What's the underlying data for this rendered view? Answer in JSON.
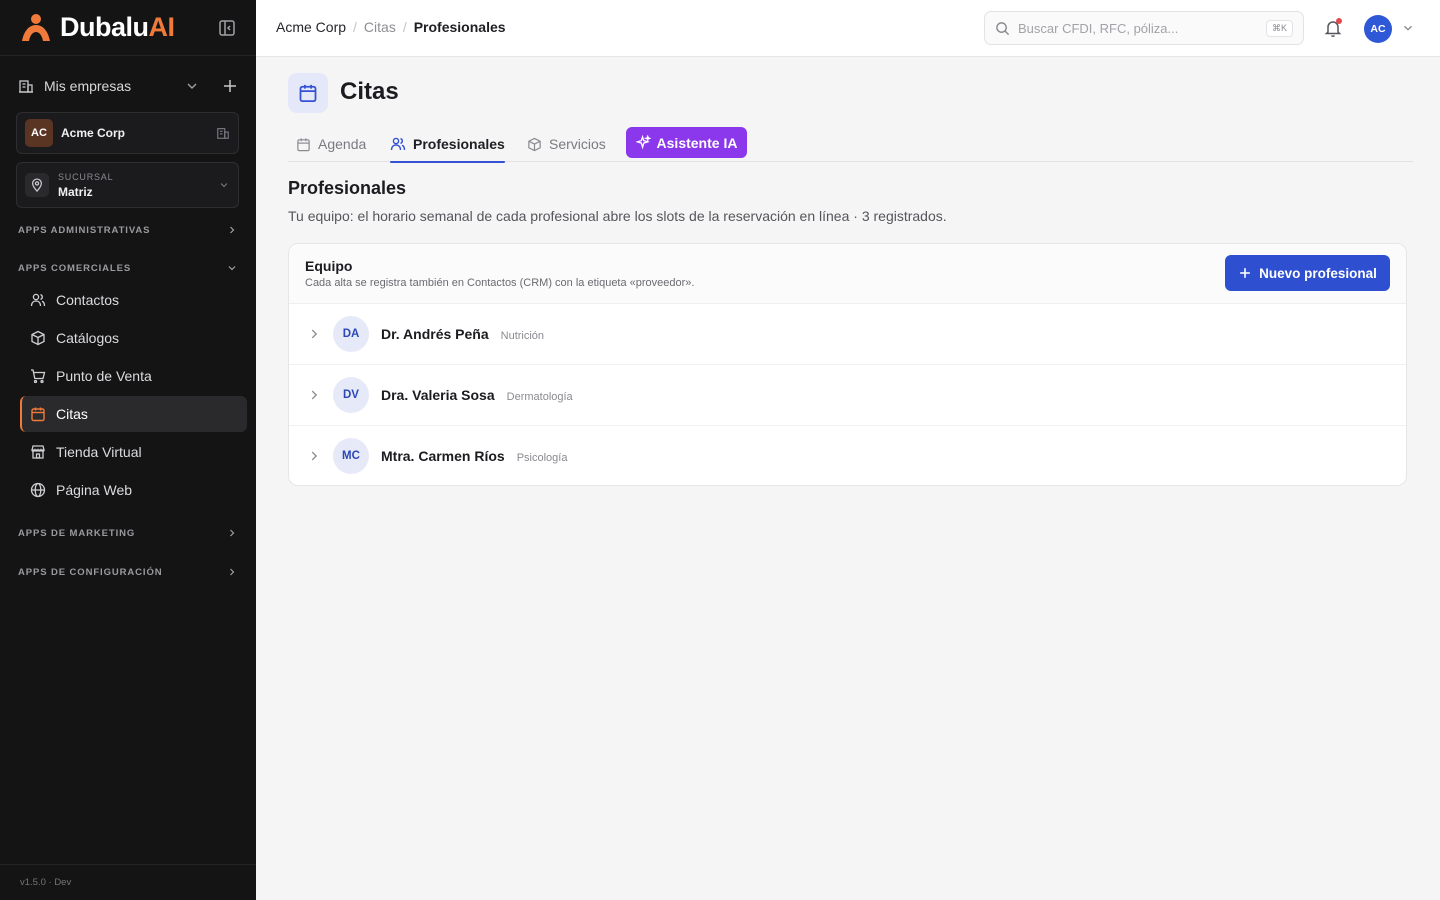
{
  "brand": {
    "name_main": "Dubalu",
    "name_accent": "AI"
  },
  "sidebar": {
    "empresas_label": "Mis empresas",
    "company": {
      "initials": "AC",
      "name": "Acme Corp"
    },
    "sucursal": {
      "label": "SUCURSAL",
      "value": "Matriz"
    },
    "sections": {
      "admin": "APPS ADMINISTRATIVAS",
      "comerciales": "APPS COMERCIALES",
      "marketing": "APPS DE MARKETING",
      "config": "APPS DE CONFIGURACIÓN"
    },
    "items": [
      {
        "label": "Contactos",
        "icon": "users-icon"
      },
      {
        "label": "Catálogos",
        "icon": "box-icon"
      },
      {
        "label": "Punto de Venta",
        "icon": "cart-icon"
      },
      {
        "label": "Citas",
        "icon": "calendar-icon"
      },
      {
        "label": "Tienda Virtual",
        "icon": "store-icon"
      },
      {
        "label": "Página Web",
        "icon": "globe-icon"
      }
    ],
    "version": "v1.5.0 · Dev"
  },
  "header": {
    "breadcrumb": [
      "Acme Corp",
      "Citas",
      "Profesionales"
    ],
    "search_placeholder": "Buscar CFDI, RFC, póliza...",
    "search_shortcut": "⌘K",
    "user_initials": "AC"
  },
  "page": {
    "title": "Citas",
    "tabs": [
      {
        "label": "Agenda"
      },
      {
        "label": "Profesionales"
      },
      {
        "label": "Servicios"
      }
    ],
    "ai_button": "Asistente IA",
    "section_title": "Profesionales",
    "section_desc": "Tu equipo: el horario semanal de cada profesional abre los slots de la reservación en línea · 3 registrados.",
    "card": {
      "title": "Equipo",
      "subtitle": "Cada alta se registra también en Contactos (CRM) con la etiqueta «proveedor».",
      "new_button": "Nuevo profesional",
      "rows": [
        {
          "initials": "DA",
          "name": "Dr. Andrés Peña",
          "specialty": "Nutrición"
        },
        {
          "initials": "DV",
          "name": "Dra. Valeria Sosa",
          "specialty": "Dermatología"
        },
        {
          "initials": "MC",
          "name": "Mtra. Carmen Ríos",
          "specialty": "Psicología"
        }
      ]
    }
  },
  "colors": {
    "accent": "#f07a3a",
    "primary": "#2e4fd0",
    "ai": "#8b38ec"
  }
}
